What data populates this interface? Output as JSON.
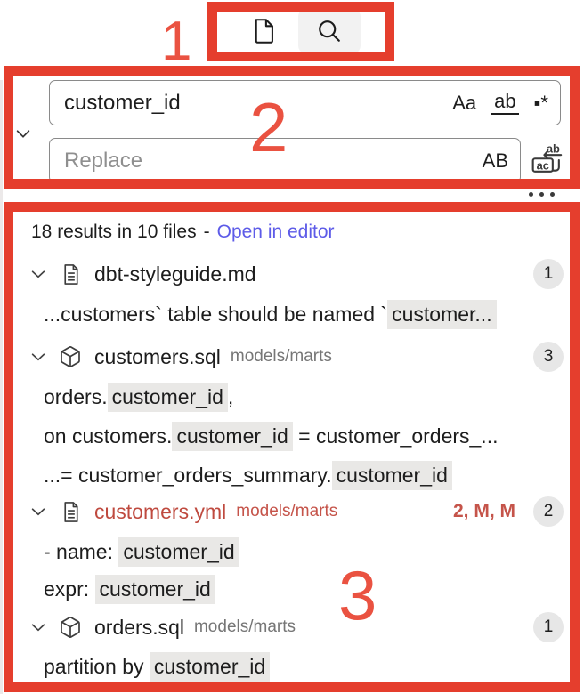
{
  "colors": {
    "annotation_red": "#e53e2d",
    "link_violet": "#5d5be8",
    "modified_file_red": "#bf4a3f",
    "decoration_red": "#c5544a",
    "match_highlight_bg": "#e9e8e6",
    "badge_bg": "#e7e7e7",
    "active_tab_bg": "#f2f2f2"
  },
  "annotations": {
    "n1": "1",
    "n2": "2",
    "n3": "3"
  },
  "icons": {
    "tab_file": "new-file",
    "tab_search": "search",
    "toggle_replace": "chevron-down",
    "replace_all": "replace-all",
    "more_actions": "ellipsis",
    "file_doc": "document",
    "file_model": "cube"
  },
  "search_panel": {
    "query": "customer_id",
    "match_case_glyph": "Aa",
    "whole_word_glyph": "ab",
    "regex_glyph": "▪*",
    "replace_placeholder": "Replace",
    "preserve_case_glyph": "AB"
  },
  "results_panel": {
    "summary": "18 results in 10 files",
    "separator": "-",
    "open_in_editor": "Open in editor",
    "files": [
      {
        "name": "dbt-styleguide.md",
        "path": "",
        "badge": "1",
        "matches": [
          [
            {
              "t": "...customers` table should be named `"
            },
            {
              "t": "customer...",
              "hl": true
            }
          ]
        ]
      },
      {
        "name": "customers.sql",
        "path": "models/marts",
        "badge": "3",
        "matches": [
          [
            {
              "t": "orders."
            },
            {
              "t": "customer_id",
              "hl": true
            },
            {
              "t": ","
            }
          ],
          [
            {
              "t": "on customers."
            },
            {
              "t": "customer_id",
              "hl": true
            },
            {
              "t": " = customer_orders_..."
            }
          ],
          [
            {
              "t": "...= customer_orders_summary."
            },
            {
              "t": "customer_id",
              "hl": true
            }
          ]
        ]
      },
      {
        "name": "customers.yml",
        "path": "models/marts",
        "decorations": "2, M, M",
        "badge": "2",
        "matches": [
          [
            {
              "t": "- name: "
            },
            {
              "t": "customer_id",
              "hl": true
            }
          ],
          [
            {
              "t": "expr: "
            },
            {
              "t": "customer_id",
              "hl": true
            }
          ]
        ]
      },
      {
        "name": "orders.sql",
        "path": "models/marts",
        "badge": "1",
        "matches": [
          [
            {
              "t": "partition by "
            },
            {
              "t": "customer_id",
              "hl": true
            }
          ]
        ]
      }
    ]
  }
}
